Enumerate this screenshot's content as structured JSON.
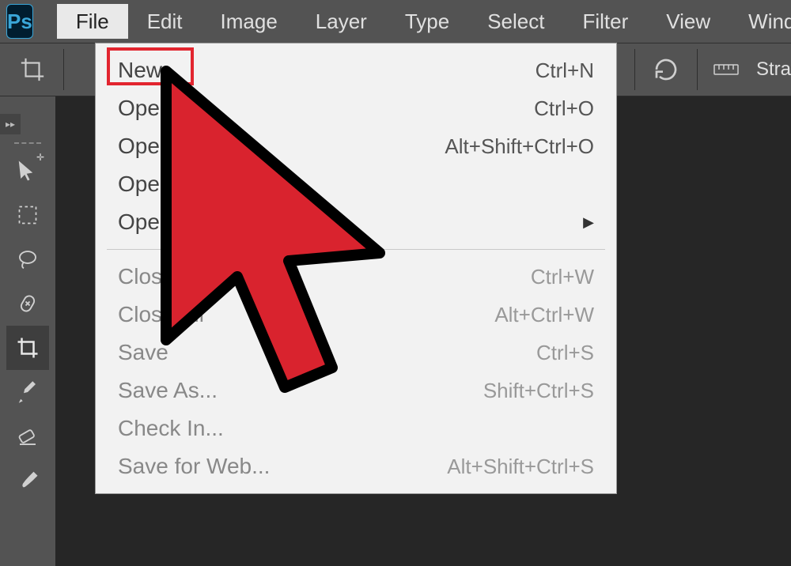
{
  "app": {
    "logo_text": "Ps"
  },
  "menu": {
    "items": [
      "File",
      "Edit",
      "Image",
      "Layer",
      "Type",
      "Select",
      "Filter",
      "View",
      "Window"
    ],
    "active_index": 0
  },
  "options_bar": {
    "right_label": "Stra"
  },
  "dropdown": {
    "groups": [
      [
        {
          "label": "New...",
          "shortcut": "Ctrl+N",
          "highlighted": true
        },
        {
          "label": "Open",
          "shortcut": "Ctrl+O"
        },
        {
          "label": "Open",
          "shortcut": "Alt+Shift+Ctrl+O"
        },
        {
          "label": "Open a",
          "shortcut": ""
        },
        {
          "label": "Open R",
          "shortcut": "",
          "submenu": true
        }
      ],
      [
        {
          "label": "Close",
          "shortcut": "Ctrl+W",
          "disabled": true
        },
        {
          "label": "Close All",
          "shortcut": "Alt+Ctrl+W",
          "disabled": true
        },
        {
          "label": "Save",
          "shortcut": "Ctrl+S",
          "disabled": true
        },
        {
          "label": "Save As...",
          "shortcut": "Shift+Ctrl+S",
          "disabled": true
        },
        {
          "label": "Check In...",
          "shortcut": "",
          "disabled": true
        },
        {
          "label": "Save for Web...",
          "shortcut": "Alt+Shift+Ctrl+S",
          "disabled": true
        }
      ]
    ]
  },
  "tools": [
    "move-tool",
    "marquee-tool",
    "lasso-tool",
    "healing-brush-tool",
    "crop-tool",
    "eyedropper-tool",
    "eraser-tool",
    "brush-tool"
  ],
  "selected_tool_index": 4
}
